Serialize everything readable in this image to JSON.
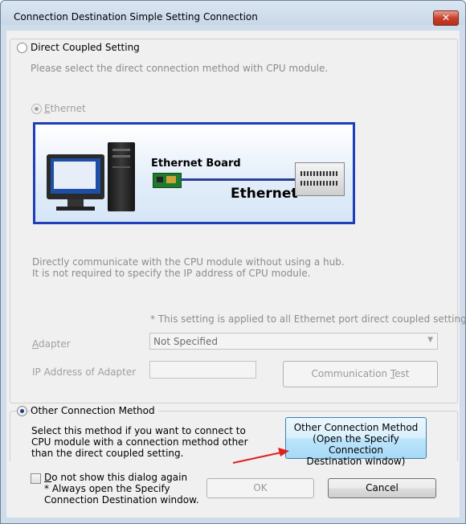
{
  "window": {
    "title": "Connection Destination Simple Setting Connection",
    "close_label": "✕"
  },
  "direct": {
    "radio_label": "Direct Coupled Setting",
    "instruction": "Please select the direct connection method with CPU module.",
    "ethernet_radio_label": "Ethernet",
    "diagram": {
      "board_label": "Ethernet Board",
      "ethernet_label": "Ethernet",
      "background_color": "#1f3fb8",
      "panel_color": "#dde9f8"
    },
    "description_line1": "Directly communicate with the CPU module without using a hub.",
    "description_line2": "It is not required to specify the IP address of CPU module.",
    "note": "* This setting is applied to all Ethernet port direct coupled settings.",
    "adapter_label": "Adapter",
    "adapter_value": "Not Specified",
    "ip_label": "IP Address of Adapter",
    "ip_value": "",
    "test_button": "Communication Test"
  },
  "other": {
    "radio_label": "Other Connection Method",
    "desc_line1": "Select this method if you want to connect to",
    "desc_line2": "CPU module with a connection method other",
    "desc_line3": "than the direct coupled setting.",
    "button_line1": "Other Connection Method",
    "button_line2": "(Open the Specify Connection",
    "button_line3": "Destination window)",
    "arrow_color": "#e02020"
  },
  "footer": {
    "checkbox_label": "Do not show this dialog again",
    "note_line1": "* Always open the Specify",
    "note_line2": "Connection Destination window.",
    "ok_label": "OK",
    "cancel_label": "Cancel"
  }
}
